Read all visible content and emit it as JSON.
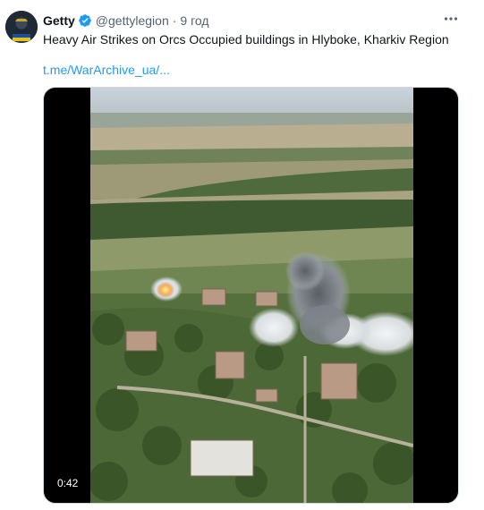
{
  "tweet": {
    "author_name": "Getty",
    "handle": "@gettylegion",
    "separator": "·",
    "time": "9 год",
    "text": "Heavy Air Strikes on Orcs Occupied buildings in Hlyboke, Kharkiv Region",
    "link_text": "t.me/WarArchive_ua/...",
    "video_duration": "0:42"
  },
  "icons": {
    "verified": "verified-badge-icon",
    "more": "more-options-icon"
  },
  "colors": {
    "link": "#1d9bf0",
    "secondary_text": "#536471",
    "verified": "#1d9bf0"
  }
}
